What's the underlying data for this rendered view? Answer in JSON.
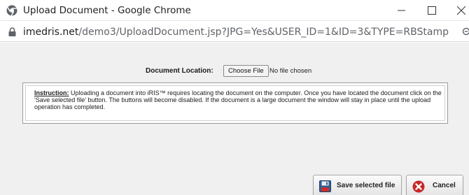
{
  "window": {
    "title": "Upload Document - Google Chrome",
    "icon": "chrome-globe-icon"
  },
  "address_bar": {
    "host": "imedris.net",
    "path": "/demo3/UploadDocument.jsp?JPG=Yes&USER_ID=1&ID=3&TYPE=RBStamp",
    "icon": "lock-icon"
  },
  "form": {
    "document_location_label": "Document Location:",
    "choose_file_label": "Choose File",
    "file_status": "No file chosen"
  },
  "instruction": {
    "title": "Instruction:",
    "text": " Uploading a document into iRIS™ requires locating the document on the computer. Once you have located the document click on the 'Save selected file' button. The buttons will become disabled. If the document is a large document the window will stay in place until the upload operation has completed."
  },
  "buttons": {
    "save_label": "Save selected file",
    "save_icon": "floppy-disk-icon",
    "cancel_label": "Cancel",
    "cancel_icon": "cancel-x-icon"
  },
  "colors": {
    "page_background": "#f0f0f0",
    "cancel_icon": "#c62828",
    "save_icon": "#2f5f95"
  }
}
